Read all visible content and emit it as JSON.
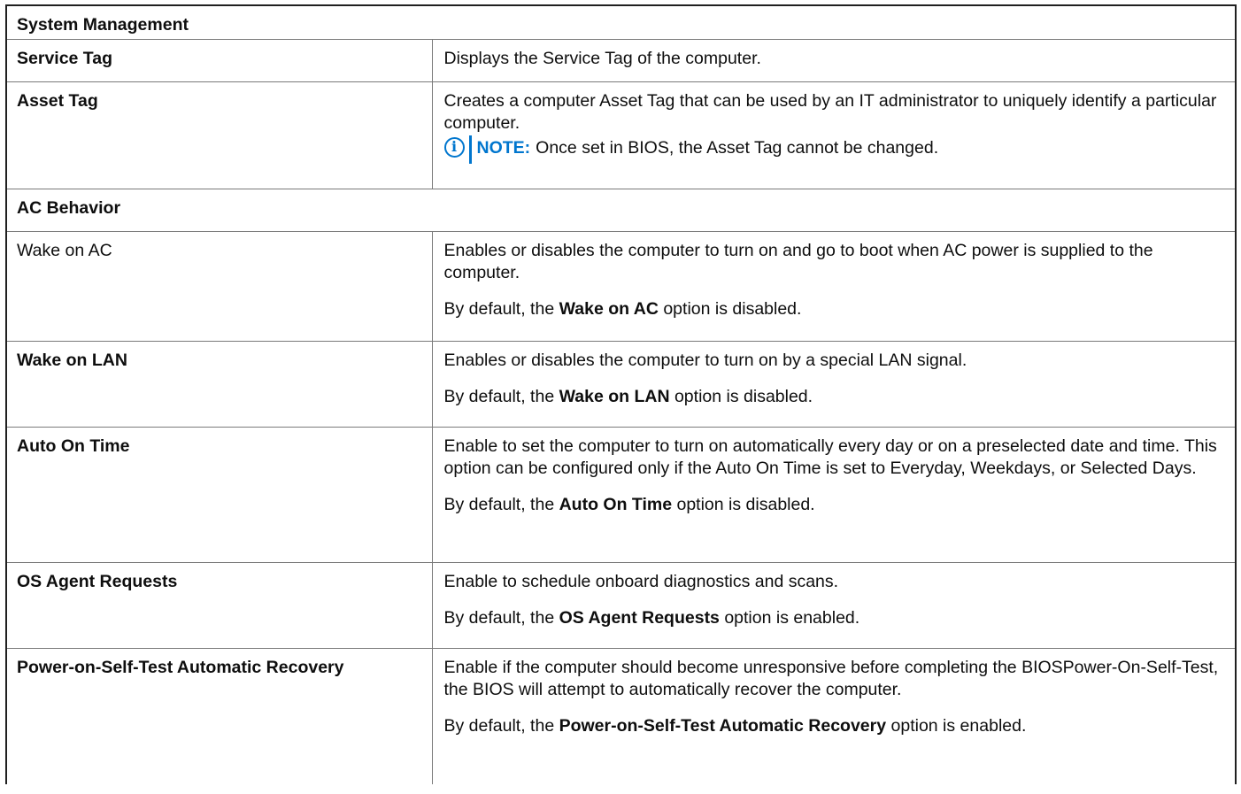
{
  "section_title": "System Management",
  "service_tag": {
    "label": "Service Tag",
    "description": "Displays the Service Tag of the computer."
  },
  "asset_tag": {
    "label": "Asset Tag",
    "description": "Creates a computer Asset Tag that can be used by an IT administrator to uniquely identify a particular computer.",
    "note_label": "NOTE:",
    "note_text": "Once set in BIOS, the Asset Tag cannot be changed."
  },
  "ac_behavior": {
    "header": "AC Behavior"
  },
  "wake_on_ac": {
    "label": "Wake on AC",
    "description": "Enables or disables the computer to turn on and go to boot when AC power is supplied to the computer.",
    "default_prefix": "By default, the ",
    "default_option": "Wake on AC",
    "default_suffix": " option is disabled."
  },
  "wake_on_lan": {
    "label": "Wake on LAN",
    "description": "Enables or disables the computer to turn on by a special LAN signal.",
    "default_prefix": "By default, the ",
    "default_option": "Wake on LAN",
    "default_suffix": " option is disabled."
  },
  "auto_on_time": {
    "label": "Auto On Time",
    "description": "Enable to set the computer to turn on automatically every day or on a preselected date and time. This option can be configured only if the Auto On Time is set to Everyday, Weekdays, or Selected Days.",
    "default_prefix": "By default, the ",
    "default_option": "Auto On Time",
    "default_suffix": " option is disabled."
  },
  "os_agent_requests": {
    "label": "OS Agent Requests",
    "description": "Enable to schedule onboard diagnostics and scans.",
    "default_prefix": "By default, the ",
    "default_option": "OS Agent Requests",
    "default_suffix": " option is enabled."
  },
  "post_recovery": {
    "label": "Power-on-Self-Test Automatic Recovery",
    "description": "Enable if the computer should become unresponsive before completing the BIOSPower-On-Self-Test, the BIOS will attempt to automatically recover the computer.",
    "default_prefix": "By default, the ",
    "default_option": "Power-on-Self-Test Automatic Recovery",
    "default_suffix": " option is enabled."
  },
  "colors": {
    "note_accent": "#0076ce",
    "border": "#7a7a7a",
    "text": "#0e0e0e"
  },
  "icons": {
    "note": "info-icon"
  }
}
